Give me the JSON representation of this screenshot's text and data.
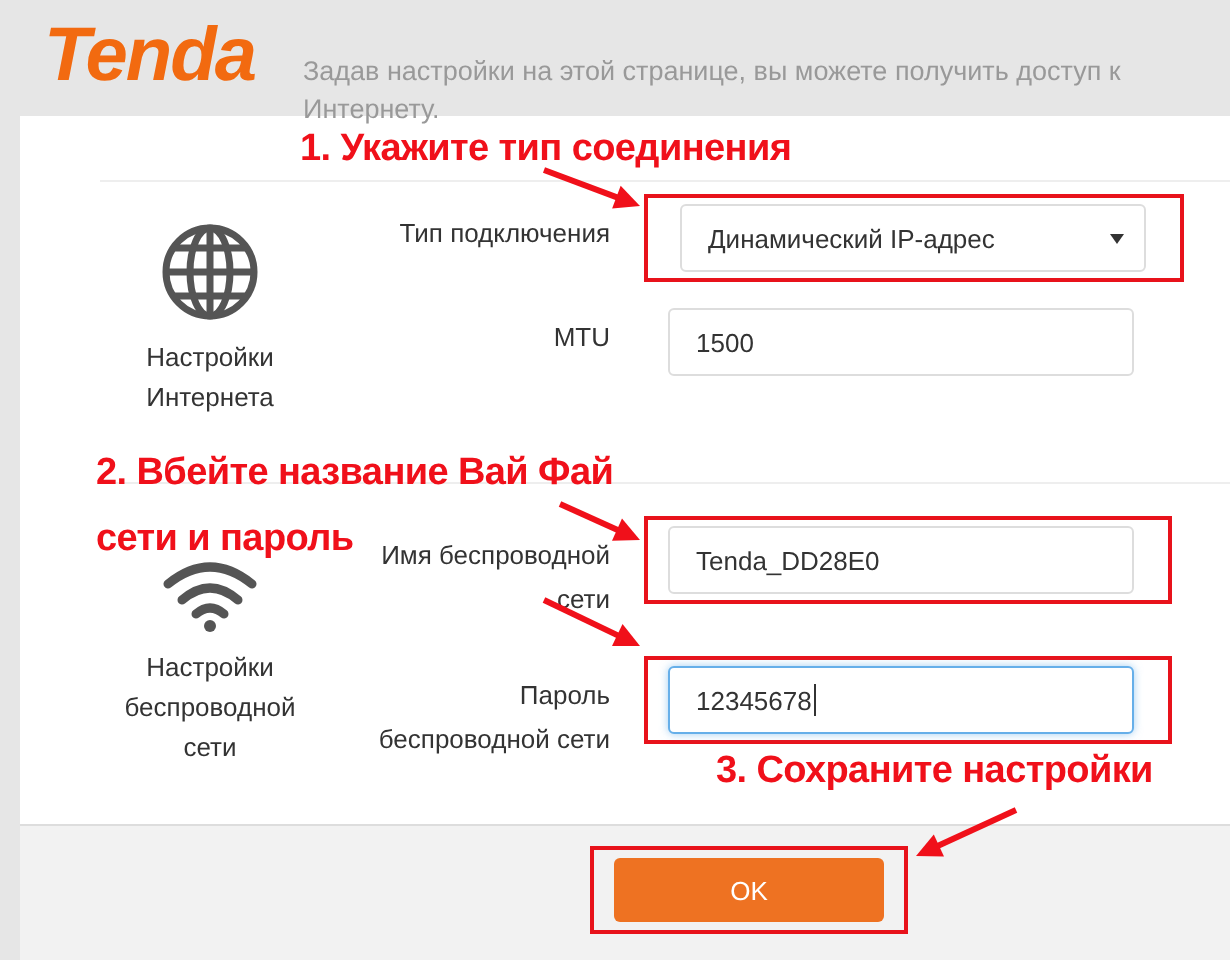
{
  "header": {
    "logo": "Tenda",
    "subtitle": "Задав настройки на этой странице, вы можете получить доступ к Интернету."
  },
  "sections": [
    {
      "title": "Настройки Интернета",
      "fields": [
        {
          "label": "Тип подключения",
          "kind": "select",
          "value": "Динамический IP-адрес",
          "highlighted": true,
          "focused": false
        },
        {
          "label": "MTU",
          "kind": "text",
          "value": "1500",
          "highlighted": false,
          "focused": false
        }
      ]
    },
    {
      "title": "Настройки беспроводной сети",
      "fields": [
        {
          "label": "Имя беспроводной сети",
          "kind": "text",
          "value": "Tenda_DD28E0",
          "highlighted": true,
          "focused": false
        },
        {
          "label": "Пароль беспроводной сети",
          "kind": "text",
          "value": "12345678",
          "highlighted": true,
          "focused": true
        }
      ]
    }
  ],
  "button": {
    "label": "OK",
    "highlighted": true
  },
  "annotations": [
    {
      "text": "1. Укажите тип соединения"
    },
    {
      "text": "2. Вбейте название Вай Фай"
    },
    {
      "text": "сети и пароль"
    },
    {
      "text": "3. Сохраните настройки"
    }
  ]
}
